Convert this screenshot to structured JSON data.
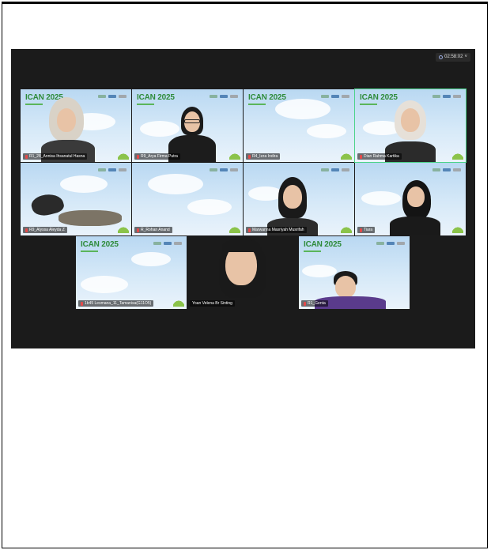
{
  "meeting": {
    "timer": "02:58:02",
    "brand": {
      "name": "ICAN",
      "year": "2025"
    },
    "participants": [
      {
        "label": "R1_28_Annisa Ihsanatul Hasna",
        "muted": true
      },
      {
        "label": "R9_Arya Firma Putra",
        "muted": true
      },
      {
        "label": "R4_Izza Indira",
        "muted": true
      },
      {
        "label": "Dian Rahma Kartika",
        "muted": true,
        "speaking": true
      },
      {
        "label": "R9_Alyssa Aleyda Z",
        "muted": true
      },
      {
        "label": "R_Rohan Anand",
        "muted": true
      },
      {
        "label": "Marwanna Masriyah Musrifah",
        "muted": true
      },
      {
        "label": "Tiara",
        "muted": true
      },
      {
        "label": "1b45 Lesmana_11_Tamanisa(G11O5)",
        "muted": true
      },
      {
        "label": "Yoan Velena Br Sinting",
        "muted": true
      },
      {
        "label": "R1_Genta",
        "muted": true
      }
    ]
  }
}
